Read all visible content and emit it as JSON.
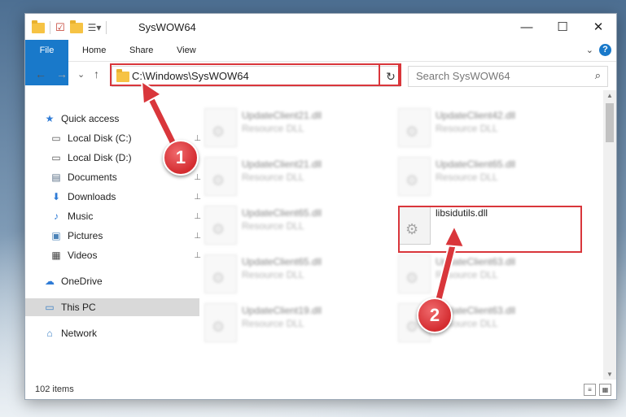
{
  "window": {
    "title": "SysWOW64",
    "controls": {
      "minimize": "—",
      "maximize": "☐",
      "close": "✕"
    }
  },
  "ribbon": {
    "tabs": [
      "File",
      "Home",
      "Share",
      "View"
    ],
    "expand_glyph": "⌄",
    "help_glyph": "?"
  },
  "nav": {
    "back": "←",
    "forward": "→",
    "recent": "⌄",
    "up": "↑",
    "address_path": "C:\\Windows\\SysWOW64",
    "address_dropdown": "⌄",
    "refresh": "↻",
    "search_placeholder": "Search SysWOW64",
    "search_icon": "⌕"
  },
  "sidebar": {
    "items": [
      {
        "label": "Quick access",
        "icon": "star-icon",
        "glyph": "★",
        "color": "#2e7bd6",
        "pinned": false
      },
      {
        "label": "Local Disk (C:)",
        "icon": "drive-icon",
        "glyph": "▭",
        "color": "#555555",
        "pinned": true
      },
      {
        "label": "Local Disk (D:)",
        "icon": "drive-icon",
        "glyph": "▭",
        "color": "#555555",
        "pinned": false
      },
      {
        "label": "Documents",
        "icon": "documents-icon",
        "glyph": "▤",
        "color": "#5a6f86",
        "pinned": true
      },
      {
        "label": "Downloads",
        "icon": "download-icon",
        "glyph": "⬇",
        "color": "#2e7bd6",
        "pinned": true
      },
      {
        "label": "Music",
        "icon": "music-icon",
        "glyph": "♪",
        "color": "#2e7bd6",
        "pinned": true
      },
      {
        "label": "Pictures",
        "icon": "pictures-icon",
        "glyph": "▣",
        "color": "#4b83b8",
        "pinned": true
      },
      {
        "label": "Videos",
        "icon": "videos-icon",
        "glyph": "▦",
        "color": "#444444",
        "pinned": true
      },
      {
        "label": "OneDrive",
        "icon": "cloud-icon",
        "glyph": "☁",
        "color": "#2e7bd6",
        "pinned": false
      },
      {
        "label": "This PC",
        "icon": "computer-icon",
        "glyph": "▭",
        "color": "#3a7fc4",
        "pinned": false,
        "selected": true
      },
      {
        "label": "Network",
        "icon": "network-icon",
        "glyph": "⌂",
        "color": "#3a7fc4",
        "pinned": false
      }
    ],
    "pin_glyph": "📌"
  },
  "files": [
    {
      "name": "UpdateClient21.dll",
      "type": "Resource DLL",
      "blurred": true
    },
    {
      "name": "UpdateClient42.dll",
      "type": "Resource DLL",
      "blurred": true
    },
    {
      "name": "UpdateClient21.dll",
      "type": "Resource DLL",
      "blurred": true
    },
    {
      "name": "UpdateClient65.dll",
      "type": "Resource DLL",
      "blurred": true
    },
    {
      "name": "UpdateClient65.dll",
      "type": "Resource DLL",
      "blurred": true
    },
    {
      "name": "libsidutils.dll",
      "type": "",
      "blurred": false
    },
    {
      "name": "UpdateClient65.dll",
      "type": "Resource DLL",
      "blurred": true
    },
    {
      "name": "UpdateClient63.dll",
      "type": "Resource DLL",
      "blurred": true
    },
    {
      "name": "UpdateClient19.dll",
      "type": "Resource DLL",
      "blurred": true
    },
    {
      "name": "UpdateClient63.dll",
      "type": "Resource DLL",
      "blurred": true
    }
  ],
  "status": {
    "item_count": "102 items"
  },
  "annotations": {
    "step1": "1",
    "step2": "2",
    "highlight_color": "#d9363b"
  }
}
